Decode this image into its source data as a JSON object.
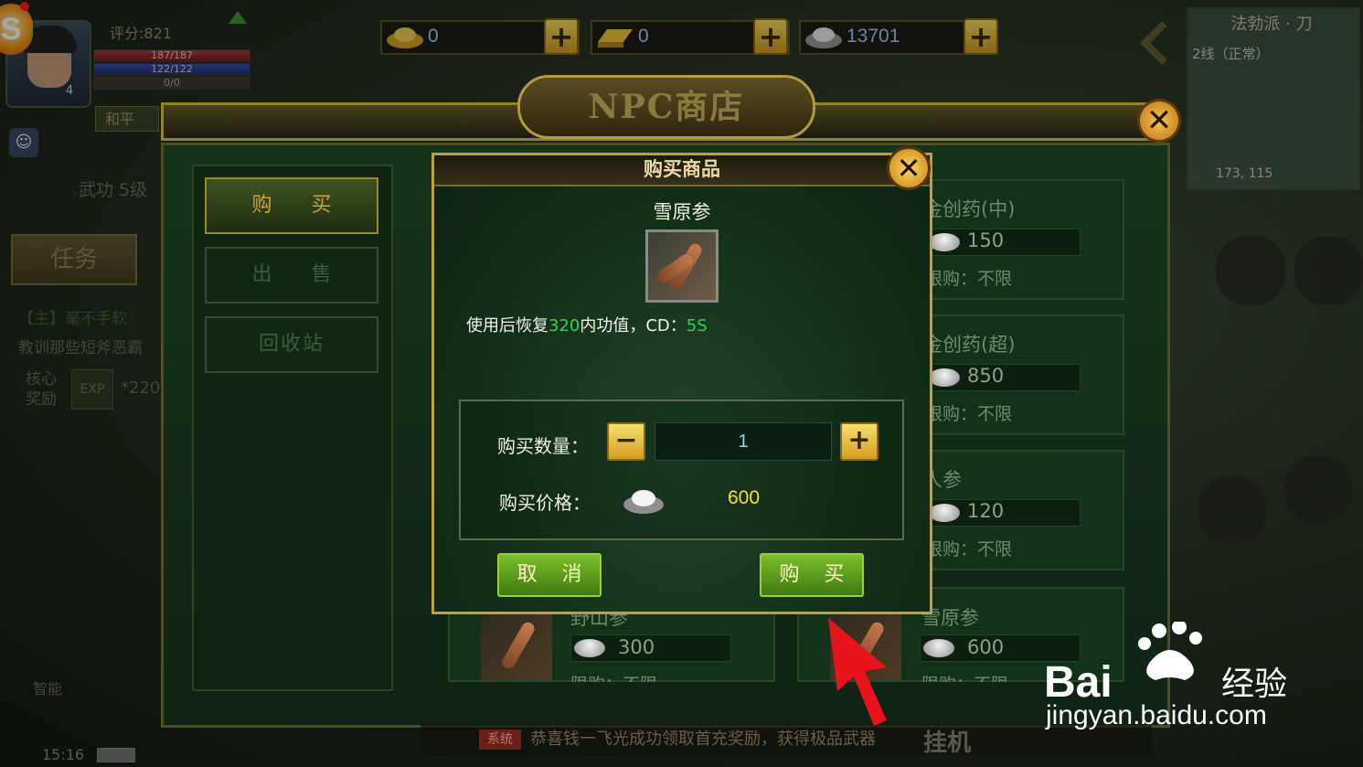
{
  "hud": {
    "score": "评分:821",
    "hp": "187/187",
    "mp": "122/122",
    "exp": "0/0",
    "level": "4",
    "mode": "和平",
    "wugong": "武功 5级",
    "task_tab": "任务",
    "task_line1": "【主】毫不手软",
    "task_line2": "教训那些短斧恶霸",
    "core_reward": "核心奖励",
    "core_value": "*220",
    "smart": "智能",
    "time": "15:16"
  },
  "currency": {
    "gold_ingot": "0",
    "gold_bar": "0",
    "silver": "13701",
    "plus": "+"
  },
  "minimap": {
    "title": "法勃派 · 刀",
    "line": "2线（正常）",
    "coord": "173, 115"
  },
  "shop": {
    "title": "NPC商店",
    "close": "✕",
    "nav": [
      "购 买",
      "出 售",
      "回收站"
    ],
    "items": [
      {
        "name": "金创药(中)",
        "price": "150",
        "limit": "限购：不限"
      },
      {
        "name": "金创药(超)",
        "price": "850",
        "limit": "限购：不限"
      },
      {
        "name": "人参",
        "price": "120",
        "limit": "限购：不限"
      }
    ],
    "bottom_items": [
      {
        "name": "野山参",
        "price": "300",
        "limit": "限购：不限"
      },
      {
        "name": "雪原参",
        "price": "600",
        "limit": "限购：不限"
      }
    ],
    "notice_tag": "系统",
    "notice": "恭喜钱一飞光成功领取首充奖励，获得极品武器",
    "hangji": "挂机"
  },
  "dialog": {
    "title": "购买商品",
    "close": "✕",
    "item_name": "雪原参",
    "desc_prefix": "使用后恢复",
    "desc_value": "320",
    "desc_mid": "内功值，CD：",
    "desc_cd": "5S",
    "qty_label": "购买数量：",
    "minus": "−",
    "qty_value": "1",
    "plus": "+",
    "price_label": "购买价格：",
    "price_value": "600",
    "cancel": "取 消",
    "buy": "购 买"
  },
  "watermark": {
    "brand": "Bai 经验",
    "url": "jingyan.baidu.com"
  }
}
